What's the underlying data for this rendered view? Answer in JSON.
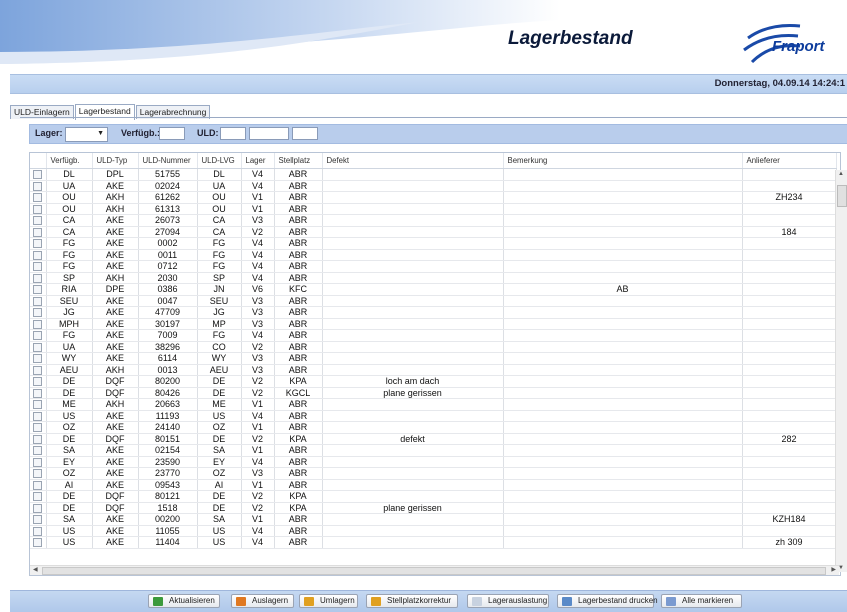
{
  "header": {
    "title": "Lagerbestand",
    "logo_text": "Fraport"
  },
  "datebar": {
    "date": "Donnerstag, 04.09.14 14:24:1"
  },
  "tabs": [
    {
      "label": "ULD-Einlagern",
      "active": false
    },
    {
      "label": "Lagerbestand",
      "active": true
    },
    {
      "label": "Lagerabrechnung",
      "active": false
    }
  ],
  "filters": {
    "lager_label": "Lager:",
    "lager_value": "",
    "verfuegb_label": "Verfügb.:",
    "verfuegb_value": "",
    "uld_label": "ULD:",
    "uld_value_1": "",
    "uld_value_2": "",
    "uld_value_3": ""
  },
  "table": {
    "columns": [
      "",
      "Verfügb.",
      "ULD-Typ",
      "ULD-Nummer",
      "ULD-LVG",
      "Lager",
      "Stellplatz",
      "Defekt",
      "Bemerkung",
      "Anlieferer"
    ],
    "rows": [
      [
        "DL",
        "DPL",
        "51755",
        "DL",
        "V4",
        "ABR",
        "",
        "",
        ""
      ],
      [
        "UA",
        "AKE",
        "02024",
        "UA",
        "V4",
        "ABR",
        "",
        "",
        ""
      ],
      [
        "OU",
        "AKH",
        "61262",
        "OU",
        "V1",
        "ABR",
        "",
        "",
        "ZH234"
      ],
      [
        "OU",
        "AKH",
        "61313",
        "OU",
        "V1",
        "ABR",
        "",
        "",
        ""
      ],
      [
        "CA",
        "AKE",
        "26073",
        "CA",
        "V3",
        "ABR",
        "",
        "",
        ""
      ],
      [
        "CA",
        "AKE",
        "27094",
        "CA",
        "V2",
        "ABR",
        "",
        "",
        "184"
      ],
      [
        "FG",
        "AKE",
        "0002",
        "FG",
        "V4",
        "ABR",
        "",
        "",
        ""
      ],
      [
        "FG",
        "AKE",
        "0011",
        "FG",
        "V4",
        "ABR",
        "",
        "",
        ""
      ],
      [
        "FG",
        "AKE",
        "0712",
        "FG",
        "V4",
        "ABR",
        "",
        "",
        ""
      ],
      [
        "SP",
        "AKH",
        "2030",
        "SP",
        "V4",
        "ABR",
        "",
        "",
        ""
      ],
      [
        "RIA",
        "DPE",
        "0386",
        "JN",
        "V6",
        "KFC",
        "",
        "AB",
        ""
      ],
      [
        "SEU",
        "AKE",
        "0047",
        "SEU",
        "V3",
        "ABR",
        "",
        "",
        ""
      ],
      [
        "JG",
        "AKE",
        "47709",
        "JG",
        "V3",
        "ABR",
        "",
        "",
        ""
      ],
      [
        "MPH",
        "AKE",
        "30197",
        "MP",
        "V3",
        "ABR",
        "",
        "",
        ""
      ],
      [
        "FG",
        "AKE",
        "7009",
        "FG",
        "V4",
        "ABR",
        "",
        "",
        ""
      ],
      [
        "UA",
        "AKE",
        "38296",
        "CO",
        "V2",
        "ABR",
        "",
        "",
        ""
      ],
      [
        "WY",
        "AKE",
        "6114",
        "WY",
        "V3",
        "ABR",
        "",
        "",
        ""
      ],
      [
        "AEU",
        "AKH",
        "0013",
        "AEU",
        "V3",
        "ABR",
        "",
        "",
        ""
      ],
      [
        "DE",
        "DQF",
        "80200",
        "DE",
        "V2",
        "KPA",
        "loch am dach",
        "",
        ""
      ],
      [
        "DE",
        "DQF",
        "80426",
        "DE",
        "V2",
        "KGCL",
        "plane gerissen",
        "",
        ""
      ],
      [
        "ME",
        "AKH",
        "20663",
        "ME",
        "V1",
        "ABR",
        "",
        "",
        ""
      ],
      [
        "US",
        "AKE",
        "11193",
        "US",
        "V4",
        "ABR",
        "",
        "",
        ""
      ],
      [
        "OZ",
        "AKE",
        "24140",
        "OZ",
        "V1",
        "ABR",
        "",
        "",
        ""
      ],
      [
        "DE",
        "DQF",
        "80151",
        "DE",
        "V2",
        "KPA",
        "defekt",
        "",
        "282"
      ],
      [
        "SA",
        "AKE",
        "02154",
        "SA",
        "V1",
        "ABR",
        "",
        "",
        ""
      ],
      [
        "EY",
        "AKE",
        "23590",
        "EY",
        "V4",
        "ABR",
        "",
        "",
        ""
      ],
      [
        "OZ",
        "AKE",
        "23770",
        "OZ",
        "V3",
        "ABR",
        "",
        "",
        ""
      ],
      [
        "AI",
        "AKE",
        "09543",
        "AI",
        "V1",
        "ABR",
        "",
        "",
        ""
      ],
      [
        "DE",
        "DQF",
        "80121",
        "DE",
        "V2",
        "KPA",
        "",
        "",
        ""
      ],
      [
        "DE",
        "DQF",
        "1518",
        "DE",
        "V2",
        "KPA",
        "plane gerissen",
        "",
        ""
      ],
      [
        "SA",
        "AKE",
        "00200",
        "SA",
        "V1",
        "ABR",
        "",
        "",
        "KZH184"
      ],
      [
        "US",
        "AKE",
        "11055",
        "US",
        "V4",
        "ABR",
        "",
        "",
        ""
      ],
      [
        "US",
        "AKE",
        "11404",
        "US",
        "V4",
        "ABR",
        "",
        "",
        "zh 309"
      ]
    ]
  },
  "footer": {
    "buttons": [
      {
        "label": "Aktualisieren",
        "icon": "refresh-icon",
        "color": "#3c9a3c"
      },
      {
        "label": "Auslagern",
        "icon": "unload-icon",
        "color": "#e07820"
      },
      {
        "label": "Umlagern",
        "icon": "relocate-icon",
        "color": "#e0a020"
      },
      {
        "label": "Stellplatzkorrektur",
        "icon": "edit-icon",
        "color": "#e0a020"
      },
      {
        "label": "Lagerauslastung",
        "icon": "document-icon",
        "color": "#c8d2e0"
      },
      {
        "label": "Lagerbestand drucken",
        "icon": "printer-icon",
        "color": "#5a8ac8"
      },
      {
        "label": "Alle markieren",
        "icon": "select-all-icon",
        "color": "#7a9ad0"
      }
    ]
  }
}
